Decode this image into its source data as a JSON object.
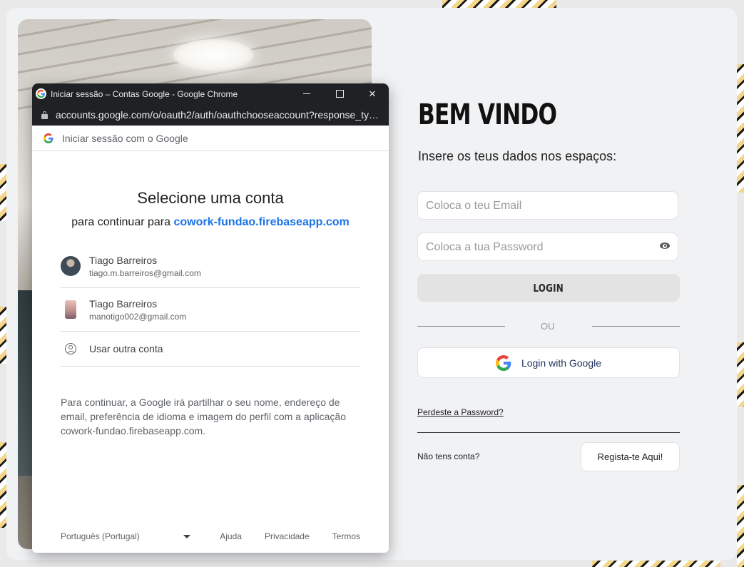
{
  "popup": {
    "window_title": "Iniciar sessão – Contas Google - Google Chrome",
    "url": "accounts.google.com/o/oauth2/auth/oauthchooseaccount?response_ty…",
    "signin_header": "Iniciar sessão com o Google",
    "title": "Selecione uma conta",
    "subtitle_prefix": "para continuar para",
    "app_name": "cowork-fundao.firebaseapp.com",
    "accounts": [
      {
        "name": "Tiago Barreiros",
        "email": "tiago.m.barreiros@gmail.com"
      },
      {
        "name": "Tiago Barreiros",
        "email": "manotigo002@gmail.com"
      }
    ],
    "other_account_label": "Usar outra conta",
    "disclaimer": "Para continuar, a Google irá partilhar o seu nome, endereço de email, preferência de idioma e imagem do perfil com a aplicação cowork-fundao.firebaseapp.com.",
    "footer": {
      "language": "Português (Portugal)",
      "links": [
        "Ajuda",
        "Privacidade",
        "Termos"
      ]
    }
  },
  "form": {
    "heading": "BEM VINDO",
    "subheading": "Insere os teus dados nos espaços:",
    "email_placeholder": "Coloca o teu Email",
    "password_placeholder": "Coloca a tua Password",
    "login_label": "LOGIN",
    "divider": "OU",
    "google_label": "Login with Google",
    "forgot_password": "Perdeste a Password?",
    "no_account": "Não tens conta?",
    "register_label": "Regista-te Aqui!"
  },
  "icons": {
    "google": "google-g-icon",
    "lock": "lock-icon",
    "eye": "eye-icon",
    "person": "person-circle-icon",
    "caret": "caret-down-icon"
  },
  "colors": {
    "brand_link": "#1a73e8",
    "titlebar": "#202124",
    "page_bg": "#f1f2f4"
  }
}
